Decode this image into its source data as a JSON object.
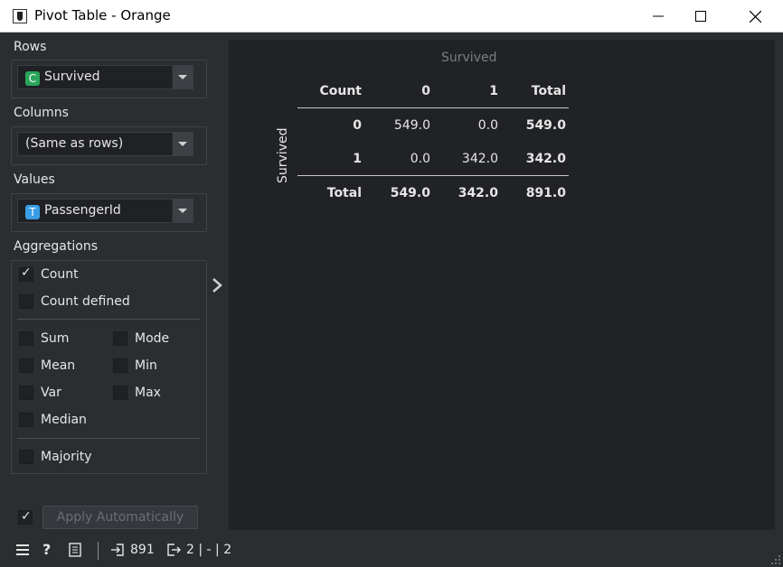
{
  "window": {
    "title": "Pivot Table - Orange"
  },
  "rows": {
    "label": "Rows",
    "selected": "Survived",
    "badge": "C",
    "badge_color": "#2aa65a"
  },
  "columns": {
    "label": "Columns",
    "selected": "(Same as rows)"
  },
  "values": {
    "label": "Values",
    "selected": "PassengerId",
    "badge": "T",
    "badge_color": "#3a9ee6"
  },
  "aggregations": {
    "label": "Aggregations",
    "count": {
      "label": "Count",
      "checked": true
    },
    "count_defined": {
      "label": "Count defined",
      "checked": false
    },
    "sum": {
      "label": "Sum",
      "checked": false
    },
    "mode": {
      "label": "Mode",
      "checked": false
    },
    "mean": {
      "label": "Mean",
      "checked": false
    },
    "min": {
      "label": "Min",
      "checked": false
    },
    "var": {
      "label": "Var",
      "checked": false
    },
    "max": {
      "label": "Max",
      "checked": false
    },
    "median": {
      "label": "Median",
      "checked": false
    },
    "majority": {
      "label": "Majority",
      "checked": false
    }
  },
  "apply": {
    "label": "Apply Automatically",
    "checked": true
  },
  "pivot": {
    "column_header": "Survived",
    "row_header": "Survived",
    "corner": "Count",
    "columns": [
      "0",
      "1",
      "Total"
    ],
    "rows": [
      {
        "label": "0",
        "values": [
          "549.0",
          "0.0",
          "549.0"
        ]
      },
      {
        "label": "1",
        "values": [
          "0.0",
          "342.0",
          "342.0"
        ]
      }
    ],
    "total": {
      "label": "Total",
      "values": [
        "549.0",
        "342.0",
        "891.0"
      ]
    }
  },
  "status": {
    "input_count": "891",
    "output_summary": "2 | - | 2"
  }
}
